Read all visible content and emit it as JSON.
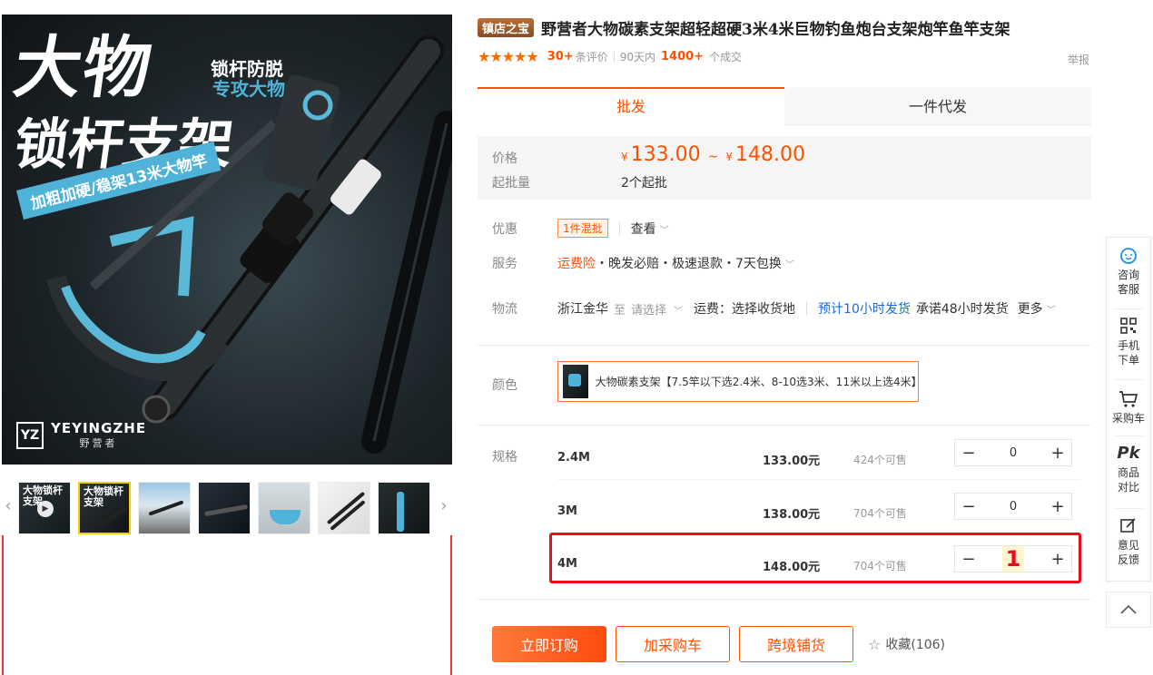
{
  "gallery": {
    "hero": {
      "title_line1": "大物",
      "title_line2": "锁杆支架",
      "sub_line1": "锁杆防脱",
      "sub_line2": "专攻大物",
      "banner": "加粗加硬/稳架13米大物竿",
      "brand_en": "YEYINGZHE",
      "brand_cn": "野营者",
      "brand_logo": "YZ"
    },
    "thumbs": [
      {
        "label": "大物锁杆支架",
        "video": true
      },
      {
        "label": "大物锁杆支架",
        "active": true
      },
      {
        "label": ""
      },
      {
        "label": ""
      },
      {
        "label": ""
      },
      {
        "label": ""
      },
      {
        "label": ""
      }
    ]
  },
  "product": {
    "badge": "镇店之宝",
    "title": "野营者大物碳素支架超轻超硬3米4米巨物钓鱼炮台支架炮竿鱼竿支架",
    "stars": "★★★★★",
    "review_count": "30+",
    "review_label": "条评价",
    "sold_prefix": "90天内",
    "sold_count": "1400+",
    "sold_label": "个成交",
    "report": "举报"
  },
  "tabs": [
    "批发",
    "一件代发"
  ],
  "pricing": {
    "price_label": "价格",
    "currency": "¥",
    "price_low": "133.00",
    "tilde": "~",
    "price_high": "148.00",
    "min_label": "起批量",
    "min_value": "2个起批"
  },
  "offer": {
    "label": "优惠",
    "tag": "1件混批",
    "view": "查看"
  },
  "service": {
    "label": "服务",
    "insurance": "运费险",
    "items": "・晚发必赔・极速退款・7天包换"
  },
  "logistics": {
    "label": "物流",
    "origin": "浙江金华",
    "to": "至",
    "select": "请选择",
    "freight": "运费：选择收货地",
    "ship_time": "预计10小时发货",
    "promise": "承诺48小时发货",
    "more": "更多"
  },
  "color": {
    "label": "颜色",
    "option": "大物碳素支架【7.5竿以下选2.4米、8-10选3米、11米以上选4米】"
  },
  "spec": {
    "label": "规格",
    "rows": [
      {
        "name": "2.4M",
        "price": "133.00元",
        "stock": "424个可售",
        "qty": "0"
      },
      {
        "name": "3M",
        "price": "138.00元",
        "stock": "704个可售",
        "qty": "0"
      },
      {
        "name": "4M",
        "price": "148.00元",
        "stock": "704个可售",
        "qty": "1"
      }
    ]
  },
  "actions": {
    "buy": "立即订购",
    "cart": "加采购车",
    "cross": "跨境铺货",
    "fav": "收藏(106)"
  },
  "toolbar": {
    "service_l1": "咨询",
    "service_l2": "客服",
    "mobile_l1": "手机",
    "mobile_l2": "下单",
    "cart": "采购车",
    "compare_l1": "商品",
    "compare_l2": "对比",
    "feedback_l1": "意见",
    "feedback_l2": "反馈"
  },
  "colors": {
    "accent": "#ff5000",
    "highlight": "#e3101b",
    "link": "#1a6bd9"
  }
}
